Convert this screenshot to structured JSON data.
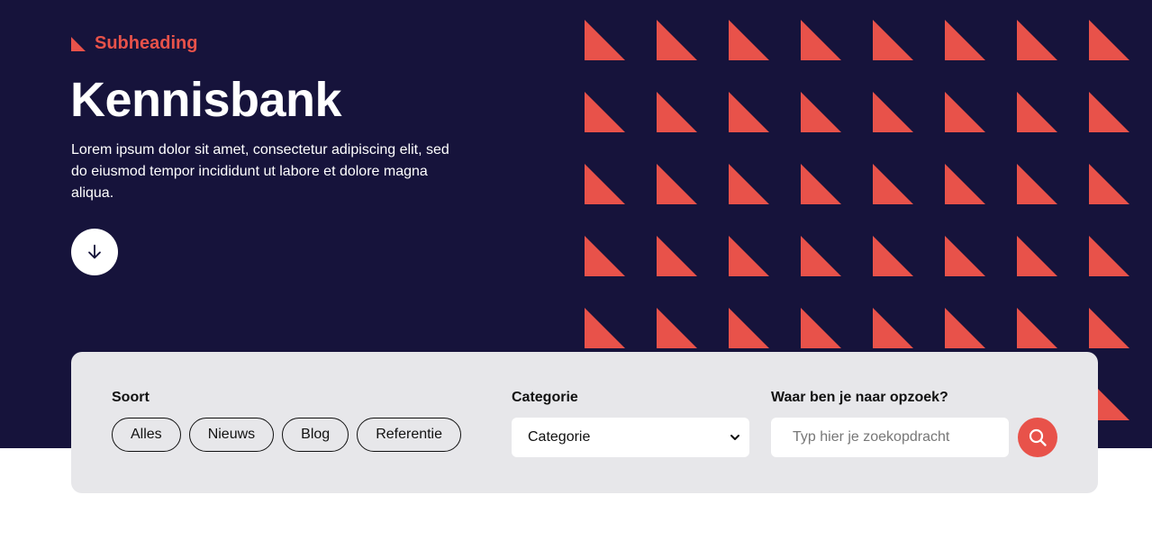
{
  "hero": {
    "subheading": "Subheading",
    "title": "Kennisbank",
    "intro": "Lorem ipsum dolor sit amet, consectetur adipiscing elit, sed do eiusmod tempor incididunt ut labore et dolore magna aliqua.",
    "scroll_icon": "arrow-down-icon"
  },
  "filters": {
    "type_label": "Soort",
    "type_options": [
      "Alles",
      "Nieuws",
      "Blog",
      "Referentie"
    ],
    "category_label": "Categorie",
    "category_value": "Categorie",
    "search_label": "Waar ben je naar opzoek?",
    "search_placeholder": "Typ hier je zoekopdracht",
    "search_icon": "search-icon"
  },
  "colors": {
    "hero_background": "#16133b",
    "accent": "#e8524a",
    "panel_background": "#e7e7ea"
  }
}
